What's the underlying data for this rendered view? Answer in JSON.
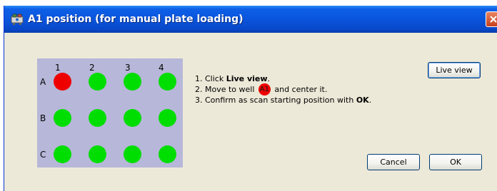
{
  "window": {
    "title": "A1 position (for manual plate loading)",
    "icon": "app-icon"
  },
  "plate": {
    "columns": [
      "1",
      "2",
      "3",
      "4"
    ],
    "rows": [
      "A",
      "B",
      "C"
    ],
    "wells": [
      [
        "red",
        "green",
        "green",
        "green"
      ],
      [
        "green",
        "green",
        "green",
        "green"
      ],
      [
        "green",
        "green",
        "green",
        "green"
      ]
    ],
    "colors": {
      "red": "#ee0000",
      "green": "#00dd00",
      "plate_bg": "#b7b7d9"
    }
  },
  "instructions": {
    "step1_prefix": "1. Click ",
    "step1_bold": "Live view",
    "step1_suffix": ".",
    "step2_prefix": "2. Move to well ",
    "step2_badge": "A1",
    "step2_suffix": " and center it.",
    "step3_prefix": "3. Confirm as scan starting position with ",
    "step3_bold": "OK",
    "step3_suffix": "."
  },
  "buttons": {
    "live_view": "Live view",
    "cancel": "Cancel",
    "ok": "OK"
  }
}
